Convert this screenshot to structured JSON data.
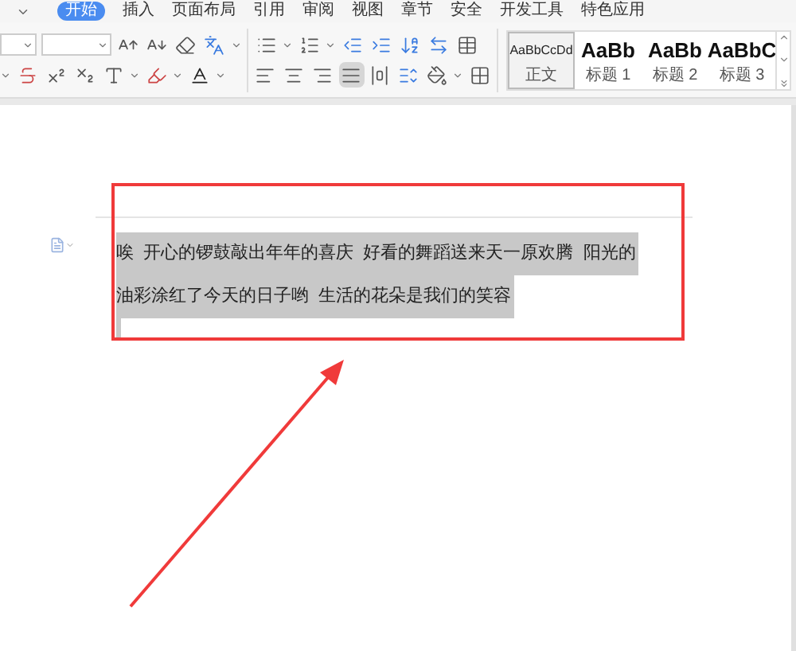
{
  "tabs": [
    {
      "label": "开始",
      "selected": true
    },
    {
      "label": "插入",
      "selected": false
    },
    {
      "label": "页面布局",
      "selected": false
    },
    {
      "label": "引用",
      "selected": false
    },
    {
      "label": "审阅",
      "selected": false
    },
    {
      "label": "视图",
      "selected": false
    },
    {
      "label": "章节",
      "selected": false
    },
    {
      "label": "安全",
      "selected": false
    },
    {
      "label": "开发工具",
      "selected": false
    },
    {
      "label": "特色应用",
      "selected": false
    }
  ],
  "alignment": [
    {
      "kind": "left",
      "selected": false
    },
    {
      "kind": "center",
      "selected": false
    },
    {
      "kind": "right",
      "selected": false
    },
    {
      "kind": "justify",
      "selected": true
    },
    {
      "kind": "distributed",
      "selected": false
    }
  ],
  "styles": [
    {
      "sample": "AaBbCcDd",
      "label": "正文",
      "kind": "body",
      "selected": true
    },
    {
      "sample": "AaBb",
      "label": "标题 1",
      "kind": "heading",
      "selected": false
    },
    {
      "sample": "AaBb",
      "label": "标题 2",
      "kind": "heading",
      "selected": false
    },
    {
      "sample": "AaBbC",
      "label": "标题 3",
      "kind": "heading",
      "selected": false
    }
  ],
  "document": {
    "lines": [
      {
        "text": "唉  开心的锣鼓敲出年年的喜庆  好看的舞蹈送来天一原欢腾  阳光的",
        "selected": true
      },
      {
        "text": "油彩涂红了今天的日子哟  生活的花朵是我们的笑容",
        "selected": true
      }
    ]
  }
}
